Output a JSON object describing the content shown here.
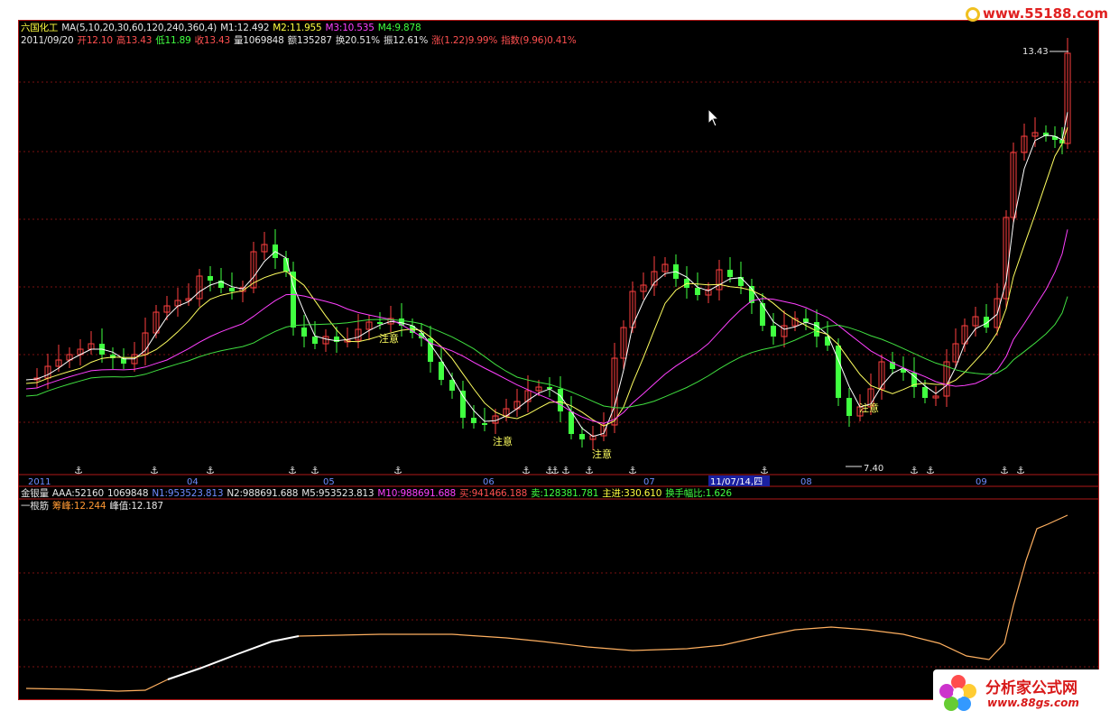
{
  "watermark_top": "www.55188.com",
  "watermark_bottom": {
    "title": "分析家公式网",
    "url": "www.88gs.com"
  },
  "header_line1": {
    "stock_name": "六国化工",
    "ma_params": "MA(5,10,20,30,60,120,240,360,4)",
    "m1": "M1:12.492",
    "m2": "M2:11.955",
    "m3": "M3:10.535",
    "m4": "M4:9.878"
  },
  "header_line2": {
    "date": "2011/09/20",
    "open": "开12.10",
    "high": "高13.43",
    "low": "低11.89",
    "close": "收13.43",
    "volume": "量1069848",
    "amount": "额135287",
    "turnover": "换20.51%",
    "amplitude": "振12.61%",
    "change": "涨(1.22)9.99%",
    "index": "指数(9.96)0.41%"
  },
  "indicator_line": {
    "name": "金银量",
    "aaa": "AAA:52160",
    "vol": "1069848",
    "n1": "N1:953523.813",
    "n2": "N2:988691.688",
    "m5": "M5:953523.813",
    "m10": "M10:988691.688",
    "buy": "买:941466.188",
    "sell": "卖:128381.781",
    "main": "主进:330.610",
    "ratio": "换手幅比:1.626"
  },
  "lower_panel": {
    "name": "一根筋",
    "chip_peak": "筹峰:12.244",
    "peak_value": "峰值:12.187"
  },
  "price_labels": {
    "high": "13.43",
    "low": "7.40"
  },
  "time_axis": {
    "labels": [
      "2011",
      "04",
      "05",
      "06",
      "07",
      "08",
      "09"
    ],
    "highlight": "11/07/14,四"
  },
  "annotations": [
    "注意",
    "注意",
    "注意",
    "注意",
    "注意"
  ],
  "colors": {
    "up": "#ff4040",
    "down": "#40ff40",
    "ma_white": "#ffffff",
    "ma_yellow": "#ffff60",
    "ma_magenta": "#ff40ff",
    "ma_green": "#40e040",
    "frame": "#b01818"
  },
  "chart_data": {
    "type": "candlestick",
    "period": "2011-01 to 2011-09-20",
    "x_labels": [
      "2011",
      "04",
      "05",
      "06",
      "07",
      "08",
      "09"
    ],
    "y_high_marked": 13.43,
    "y_low_marked": 7.4,
    "last_bar": {
      "open": 12.1,
      "high": 13.43,
      "low": 11.89,
      "close": 13.43
    },
    "ma_values": {
      "M1": 12.492,
      "M2": 11.955,
      "M3": 10.535,
      "M4": 9.878
    }
  }
}
